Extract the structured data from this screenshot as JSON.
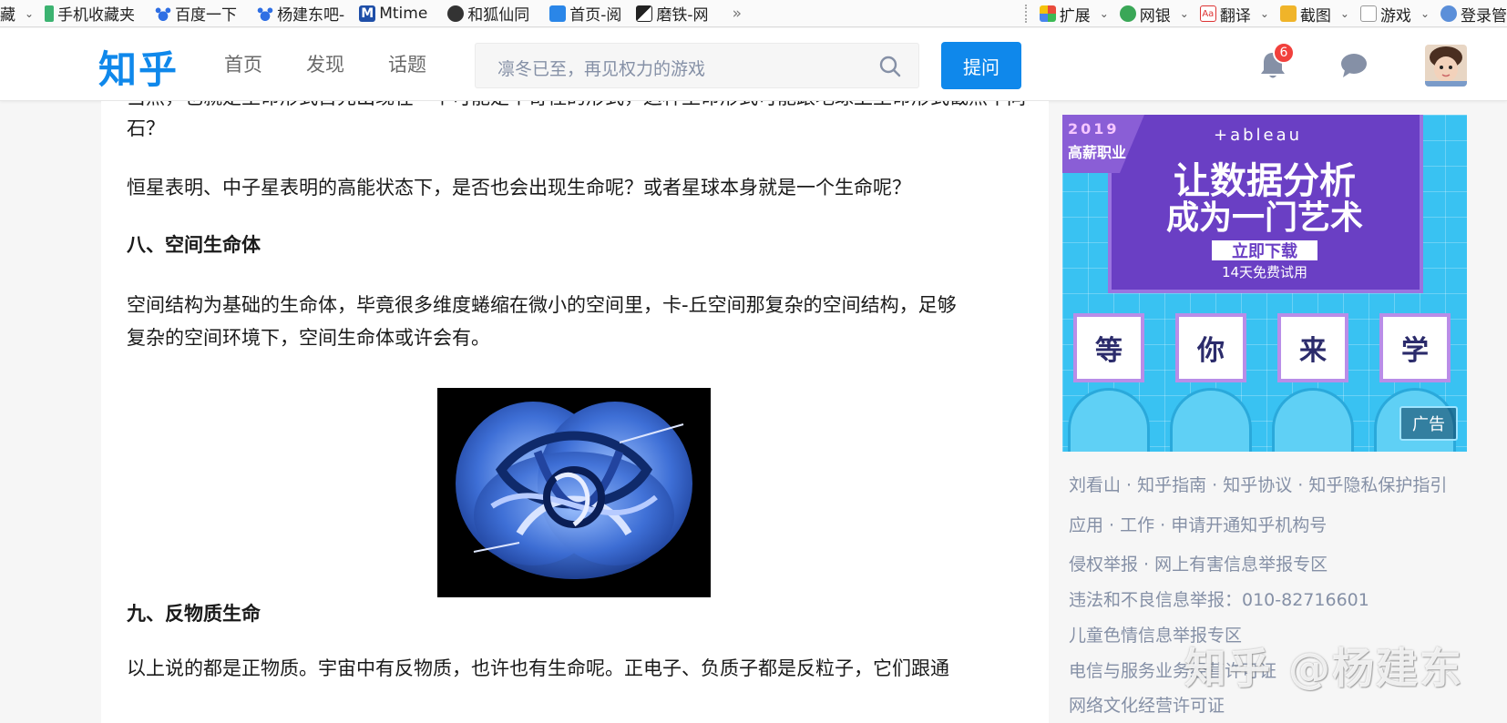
{
  "bookmarks": {
    "left": [
      {
        "label": "藏",
        "icon": "bookmark-icon"
      },
      {
        "label": "手机收藏夹",
        "icon": "phone-icon"
      },
      {
        "label": "百度一下",
        "icon": "baidu-paw-icon"
      },
      {
        "label": "杨建东吧-",
        "icon": "baidu-paw-icon"
      },
      {
        "label": "Mtime",
        "icon": "mtime-icon"
      },
      {
        "label": "和狐仙同",
        "icon": "sohu-fox-icon"
      },
      {
        "label": "首页-阅",
        "icon": "page-icon"
      },
      {
        "label": "磨铁-网",
        "icon": "motie-icon"
      },
      {
        "label": "»",
        "icon": "more-icon"
      }
    ],
    "right": [
      {
        "label": "扩展",
        "icon": "extensions-icon"
      },
      {
        "label": "网银",
        "icon": "bank-shield-icon"
      },
      {
        "label": "翻译",
        "icon": "translate-icon"
      },
      {
        "label": "截图",
        "icon": "screenshot-icon"
      },
      {
        "label": "游戏",
        "icon": "game-icon"
      },
      {
        "label": "登录管",
        "icon": "login-key-icon"
      }
    ]
  },
  "header": {
    "logo": "知乎",
    "nav": [
      "首页",
      "发现",
      "话题"
    ],
    "search_placeholder": "凛冬已至，再见权力的游戏",
    "ask_label": "提问",
    "notification_count": "6"
  },
  "article": {
    "cut_line": "当然，也就是生命形式首先出现在一个可能是个奇怪的形式，这种生命形式可能跟地球上生命形式截然不同，或者说是不是还有硅基生命，比如岩",
    "p1_end": "石？",
    "p2": "恒星表明、中子星表明的高能状态下，是否也会出现生命呢？或者星球本身就是一个生命呢？",
    "h8": "八、空间生命体",
    "p3_line1": "空间结构为基础的生命体，毕竟很多维度蜷缩在微小的空间里，卡-丘空间那复杂的空间结构，足够",
    "p3_line2": "复杂的空间环境下，空间生命体或许会有。",
    "h9": "九、反物质生命",
    "p4": "以上说的都是正物质。宇宙中有反物质，也许也有生命呢。正电子、负质子都是反粒子，它们跟通"
  },
  "ad": {
    "year": "2019",
    "tag": "高薪职业",
    "brand": "+ableau",
    "line1": "让数据分析",
    "line2": "成为一门艺术",
    "button": "立即下载",
    "sub": "14天免费试用",
    "cards": [
      "等",
      "你",
      "来",
      "学"
    ],
    "label": "广告"
  },
  "footer": {
    "row1": "刘看山 · 知乎指南 · 知乎协议 · 知乎隐私保护指引",
    "row2": "应用 · 工作 · 申请开通知乎机构号",
    "row3": "侵权举报 · 网上有害信息举报专区",
    "row4": "违法和不良信息举报：010-82716601",
    "row5": "儿童色情信息举报专区",
    "row6": "电信与服务业务经营许可证",
    "row7": "网络文化经营许可证"
  },
  "watermark": "知乎 @杨建东"
}
